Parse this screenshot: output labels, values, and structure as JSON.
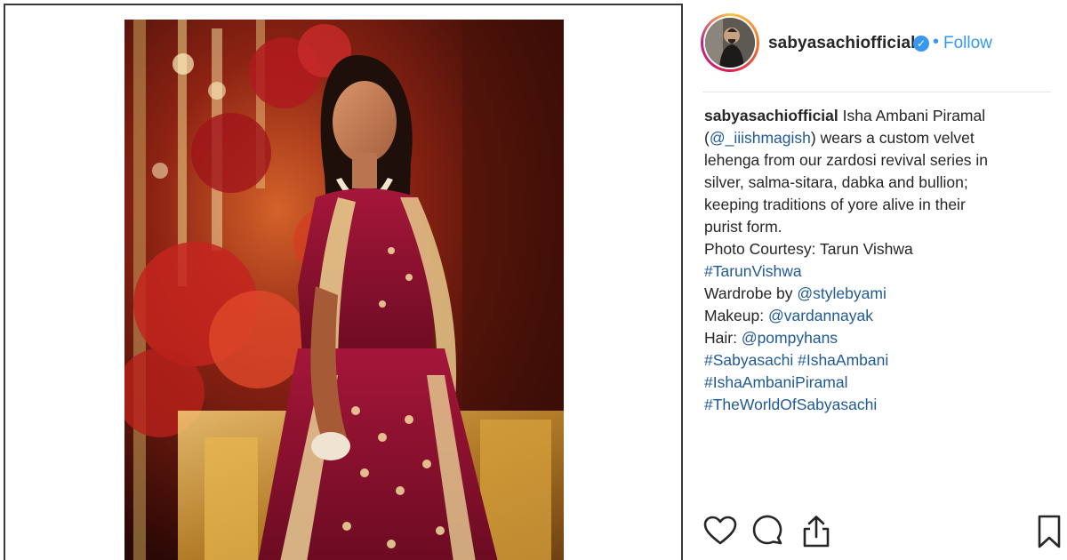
{
  "post": {
    "author": {
      "username": "sabyasachiofficial",
      "verified_mark": "✓",
      "separator": "•",
      "follow_label": "Follow"
    },
    "media": {
      "icon": "photo-of-bride-in-lehenga"
    },
    "caption": {
      "username": "sabyasachiofficial",
      "line1_text": " Isha Ambani Piramal",
      "line2_mention": "@_iiishmagish",
      "line2_open": "(",
      "line2_close": ") wears a custom velvet",
      "line3": "lehenga from our zardosi revival series in",
      "line4": "silver, salma-sitara, dabka and bullion;",
      "line5": "keeping traditions of yore alive in their",
      "line6": "purist form.",
      "line7": "Photo Courtesy: Tarun Vishwa",
      "line8_tag": "#TarunVishwa",
      "line9_prefix": "Wardrobe by ",
      "line9_mention": "@stylebyami",
      "line10_prefix": "Makeup: ",
      "line10_mention": "@vardannayak",
      "line11_prefix": "Hair: ",
      "line11_mention": "@pompyhans",
      "line12_tag1": "#Sabyasachi",
      "line12_tag2": "#IshaAmbani",
      "line13_tag": "#IshaAmbaniPiramal",
      "line14_tag": "#TheWorldOfSabyasachi"
    },
    "actions": {
      "like_icon": "heart-icon",
      "comment_icon": "comment-icon",
      "share_icon": "share-icon",
      "save_icon": "bookmark-icon"
    },
    "colors": {
      "link": "#1f5a96",
      "follow": "#3897f0",
      "text": "#262626"
    }
  }
}
